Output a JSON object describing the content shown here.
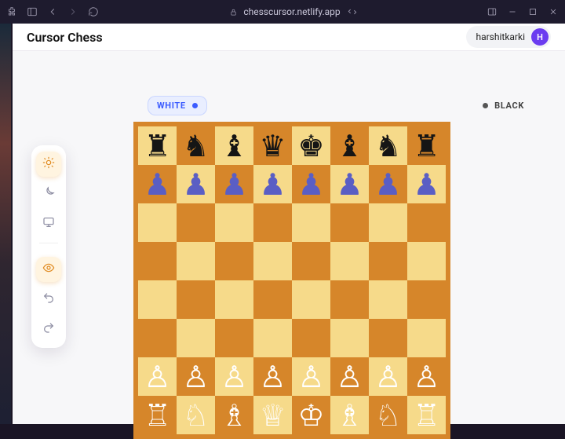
{
  "browser": {
    "url_host": "chesscursor.netlify.app"
  },
  "app": {
    "title": "Cursor Chess",
    "user": {
      "name": "harshitkarki",
      "initial": "H"
    }
  },
  "turn": {
    "white_label": "WHITE",
    "black_label": "BLACK",
    "active": "white"
  },
  "toolrail": [
    {
      "name": "theme-light",
      "active": true
    },
    {
      "name": "theme-dark",
      "active": false
    },
    {
      "name": "theme-system",
      "active": false
    },
    {
      "name": "visibility",
      "active": true
    },
    {
      "name": "undo",
      "active": false
    },
    {
      "name": "redo",
      "active": false
    }
  ],
  "board": {
    "rows": [
      [
        "br",
        "bn",
        "bb",
        "bq",
        "bk",
        "bb",
        "bn",
        "br"
      ],
      [
        "bp",
        "bp",
        "bp",
        "bp",
        "bp",
        "bp",
        "bp",
        "bp"
      ],
      [
        "",
        "",
        "",
        "",
        "",
        "",
        "",
        ""
      ],
      [
        "",
        "",
        "",
        "",
        "",
        "",
        "",
        ""
      ],
      [
        "",
        "",
        "",
        "",
        "",
        "",
        "",
        ""
      ],
      [
        "",
        "",
        "",
        "",
        "",
        "",
        "",
        ""
      ],
      [
        "wp",
        "wp",
        "wp",
        "wp",
        "wp",
        "wp",
        "wp",
        "wp"
      ],
      [
        "wr",
        "wn",
        "wb",
        "wq",
        "wk",
        "wb",
        "wn",
        "wr"
      ]
    ]
  },
  "colors": {
    "board_light": "#f6da8a",
    "board_dark": "#d6862a",
    "accent_blue": "#3b5bff",
    "accent_orange": "#e08a1f",
    "avatar": "#6b3cf0"
  }
}
